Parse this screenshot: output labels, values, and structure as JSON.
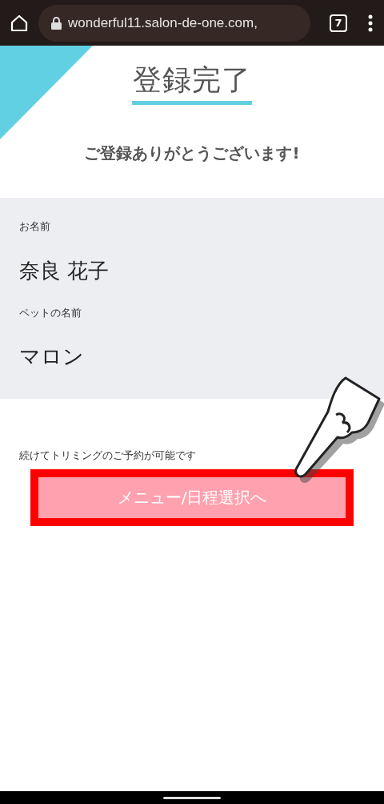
{
  "browser": {
    "url": "wonderful11.salon-de-one.com,",
    "tab_count": "7"
  },
  "page": {
    "title": "登録完了",
    "thanks": "ご登録ありがとうございます!"
  },
  "fields": [
    {
      "label": "お名前",
      "value": "奈良 花子"
    },
    {
      "label": "ペットの名前",
      "value": "マロン"
    }
  ],
  "note": "続けてトリミングのご予約が可能です",
  "button": {
    "label": "メニュー/日程選択へ",
    "highlighted": true
  }
}
